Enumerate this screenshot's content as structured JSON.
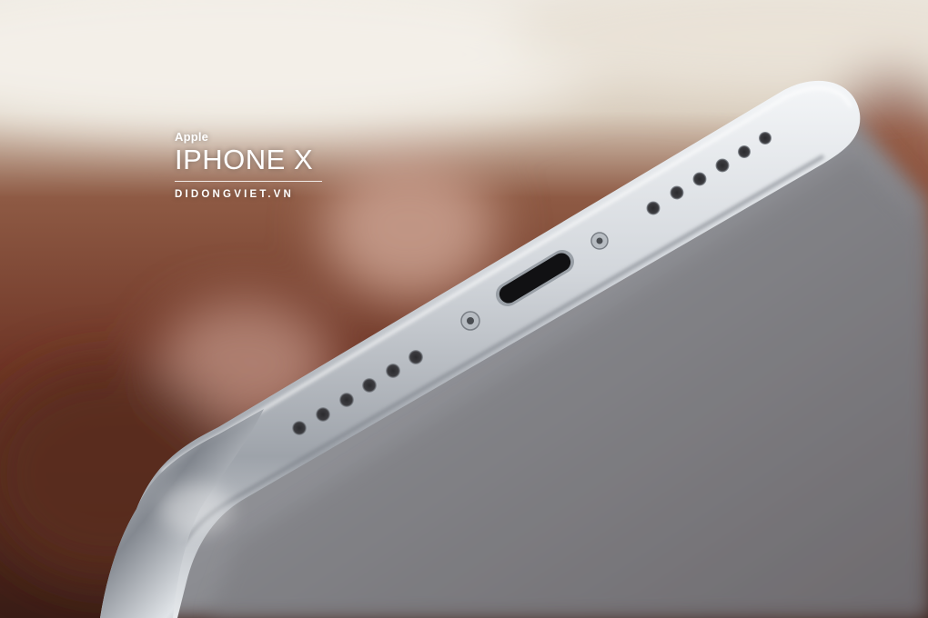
{
  "watermark": {
    "brand": "Apple",
    "model": "IPHONE X",
    "site": "DIDONGVIET.VN"
  },
  "colors": {
    "background_wall": "#e8e2d6",
    "background_wood": "#7a3e2a",
    "phone_steel": "#c9cdd2",
    "phone_glass": "#8f9196"
  },
  "photo_subject": {
    "object-1": "phone-bottom-edge",
    "object-2": "lightning-port",
    "object-3": "speaker-grille-left",
    "object-4": "speaker-grille-right",
    "object-5": "pentalobe-screws"
  }
}
